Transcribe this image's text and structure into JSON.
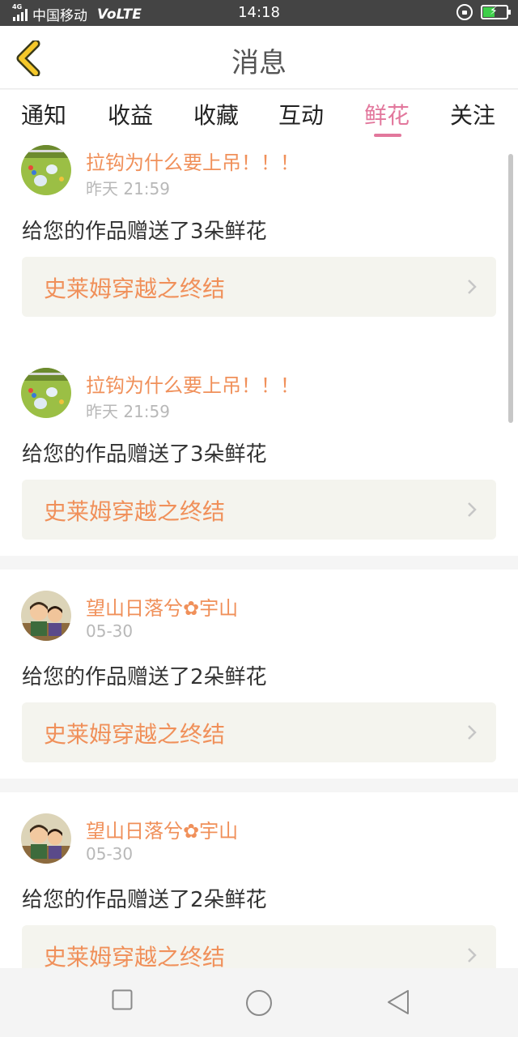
{
  "status_bar": {
    "network_tag": "4G",
    "carrier": "中国移动",
    "volte": "VoLTE",
    "time": "14:18",
    "icons": [
      "signal-icon",
      "rotation-lock-icon",
      "battery-charging-icon"
    ],
    "battery_level": 0.45,
    "battery_color": "#3ecf4a"
  },
  "header": {
    "title": "消息",
    "back_icon": "chevron-left-icon",
    "back_icon_color": "#f5c82a"
  },
  "tabs": [
    {
      "label": "通知",
      "active": false
    },
    {
      "label": "收益",
      "active": false
    },
    {
      "label": "收藏",
      "active": false
    },
    {
      "label": "互动",
      "active": false
    },
    {
      "label": "鲜花",
      "active": true
    },
    {
      "label": "关注",
      "active": false
    }
  ],
  "accent_color": "#e2779c",
  "name_color": "#f0905a",
  "items": [
    {
      "name": "拉钩为什么要上吊！！！",
      "time": "昨天 21:59",
      "message": "给您的作品赠送了3朵鲜花",
      "work_title": "史莱姆穿越之终结",
      "avatar": "game-avatar"
    },
    {
      "name": "拉钩为什么要上吊！！！",
      "time": "昨天 21:59",
      "message": "给您的作品赠送了3朵鲜花",
      "work_title": "史莱姆穿越之终结",
      "avatar": "game-avatar"
    },
    {
      "name": "望山日落兮✿宇山",
      "time": "05-30",
      "message": "给您的作品赠送了2朵鲜花",
      "work_title": "史莱姆穿越之终结",
      "avatar": "cartoon-kids-avatar"
    },
    {
      "name": "望山日落兮✿宇山",
      "time": "05-30",
      "message": "给您的作品赠送了2朵鲜花",
      "work_title": "史莱姆穿越之终结",
      "avatar": "cartoon-kids-avatar"
    }
  ],
  "nav_bar": {
    "buttons": [
      "recent-apps-icon",
      "home-icon",
      "back-icon"
    ]
  }
}
